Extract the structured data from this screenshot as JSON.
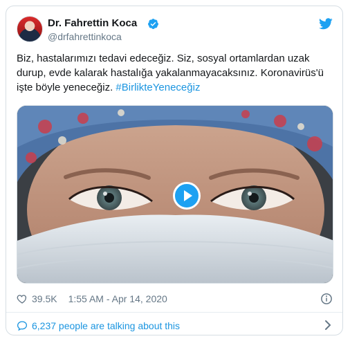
{
  "author": {
    "name": "Dr. Fahrettin Koca",
    "handle": "@drfahrettinkoca"
  },
  "tweet": {
    "text_plain": "Biz, hastalarımızı tedavi edeceğiz. Siz, sosyal ortamlardan uzak durup, evde kalarak hastalığa yakalanmayacaksınız. Koronavirüs'ü işte böyle yeneceğiz.",
    "hashtag": "#BirlikteYeneceğiz"
  },
  "meta": {
    "likes": "39.5K",
    "timestamp": "1:55 AM - Apr 14, 2020"
  },
  "footer": {
    "talking_label": "6,237 people are talking about this"
  },
  "icons": {
    "verified": "verified-badge-icon",
    "brand": "twitter-bird-icon",
    "like": "heart-icon",
    "info": "info-icon",
    "talking": "speech-bubble-icon",
    "chevron": "chevron-right-icon",
    "play": "play-icon"
  },
  "colors": {
    "brand_blue": "#1da1f2",
    "link_blue": "#1b95e0",
    "text_primary": "#14171a",
    "text_secondary": "#657786"
  }
}
